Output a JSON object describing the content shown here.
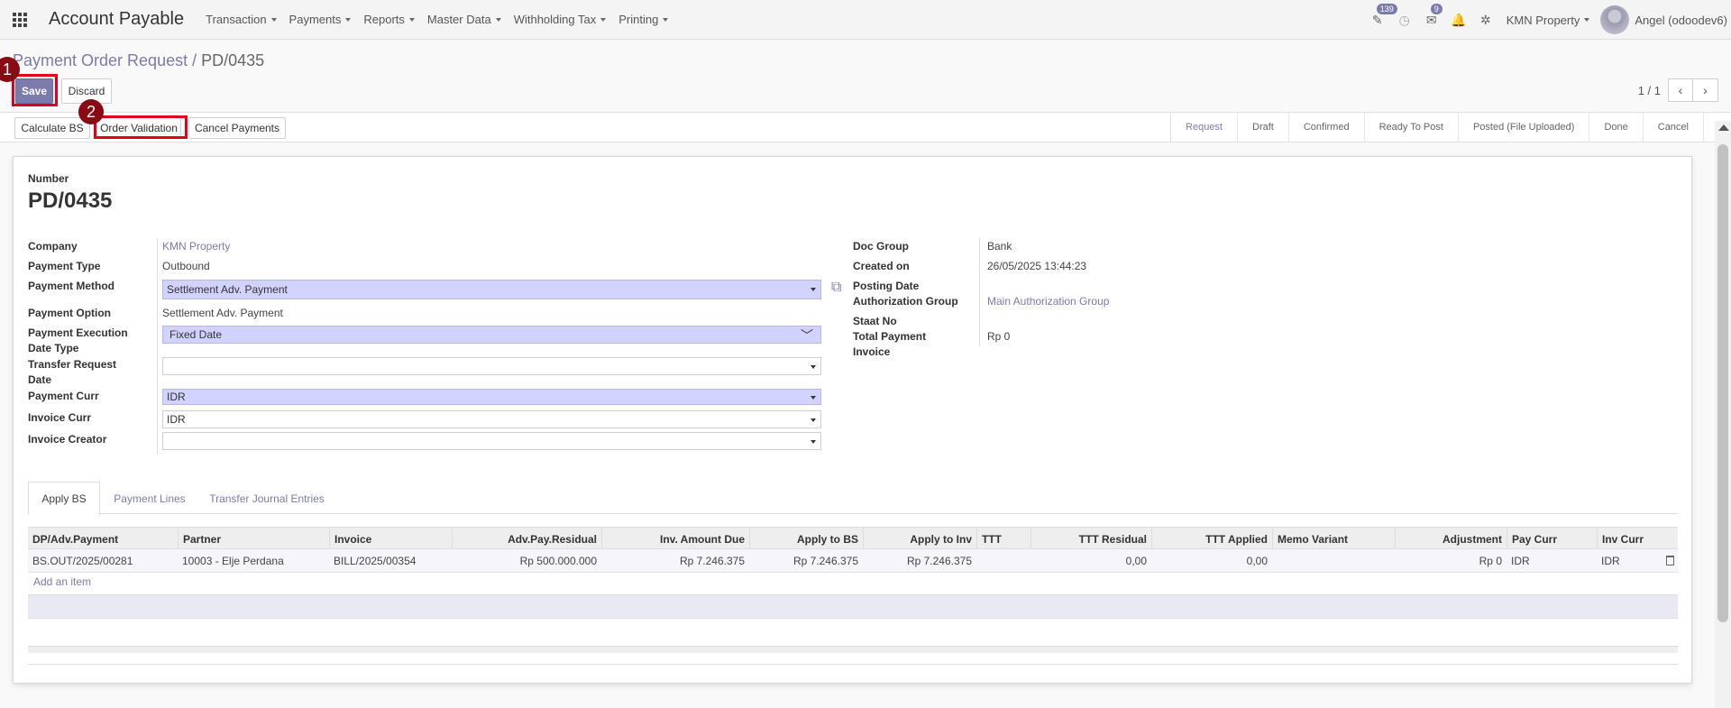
{
  "app": {
    "title": "Account Payable",
    "menu": [
      "Transaction",
      "Payments",
      "Reports",
      "Master Data",
      "Withholding Tax",
      "Printing"
    ]
  },
  "systray": {
    "activity_count": "139",
    "messages_count": "9",
    "company": "KMN Property",
    "user": "Angel (odoodev6)"
  },
  "breadcrumb": {
    "parent": "Payment Order Request",
    "separator": "/",
    "current": "PD/0435"
  },
  "actions": {
    "save": "Save",
    "discard": "Discard"
  },
  "annotations": {
    "step1": "1",
    "step2": "2"
  },
  "pager": {
    "text": "1 / 1",
    "prev": "‹",
    "next": "›"
  },
  "header_buttons": [
    "Calculate BS",
    "Order Validation",
    "Cancel Payments"
  ],
  "stages": [
    {
      "label": "Request",
      "active": true
    },
    {
      "label": "Draft",
      "active": false
    },
    {
      "label": "Confirmed",
      "active": false
    },
    {
      "label": "Ready To Post",
      "active": false
    },
    {
      "label": "Posted (File Uploaded)",
      "active": false
    },
    {
      "label": "Done",
      "active": false
    },
    {
      "label": "Cancel",
      "active": false
    }
  ],
  "form": {
    "number_label": "Number",
    "number": "PD/0435",
    "left": {
      "company_label": "Company",
      "company": "KMN Property",
      "payment_type_label": "Payment Type",
      "payment_type": "Outbound",
      "payment_method_label": "Payment Method",
      "payment_method": "Settlement Adv. Payment",
      "payment_option_label": "Payment Option",
      "payment_option": "Settlement Adv. Payment",
      "exec_date_type_label_1": "Payment Execution",
      "exec_date_type_label_2": "Date Type",
      "exec_date_type": "Fixed Date",
      "transfer_request_label_1": "Transfer Request",
      "transfer_request_label_2": "Date",
      "transfer_request": "",
      "payment_curr_label": "Payment Curr",
      "payment_curr": "IDR",
      "invoice_curr_label": "Invoice Curr",
      "invoice_curr": "IDR",
      "invoice_creator_label": "Invoice Creator",
      "invoice_creator": ""
    },
    "right": {
      "doc_group_label": "Doc Group",
      "doc_group": "Bank",
      "created_on_label": "Created on",
      "created_on": "26/05/2025 13:44:23",
      "posting_date_label": "Posting Date",
      "auth_group_label": "Authorization Group",
      "auth_group": "Main Authorization Group",
      "staat_no_label": "Staat No",
      "total_payment_label_1": "Total Payment",
      "total_payment_label_2": "Invoice",
      "total_payment": "Rp 0"
    }
  },
  "tabs": [
    "Apply BS",
    "Payment Lines",
    "Transfer Journal Entries"
  ],
  "table": {
    "columns": [
      "DP/Adv.Payment",
      "Partner",
      "Invoice",
      "Adv.Pay.Residual",
      "Inv. Amount Due",
      "Apply to BS",
      "Apply to Inv",
      "TTT",
      "TTT Residual",
      "TTT Applied",
      "Memo Variant",
      "Adjustment",
      "Pay Curr",
      "Inv Curr"
    ],
    "rows": [
      [
        "BS.OUT/2025/00281",
        "10003 - Elje Perdana",
        "BILL/2025/00354",
        "Rp 500.000.000",
        "Rp 7.246.375",
        "Rp 7.246.375",
        "Rp 7.246.375",
        "",
        "0,00",
        "0,00",
        "",
        "Rp 0",
        "IDR",
        "IDR"
      ]
    ],
    "add_item": "Add an item"
  },
  "colors": {
    "accent": "#7c7bad",
    "required_field": "#d2d2ff",
    "highlight": "#e0001b"
  }
}
